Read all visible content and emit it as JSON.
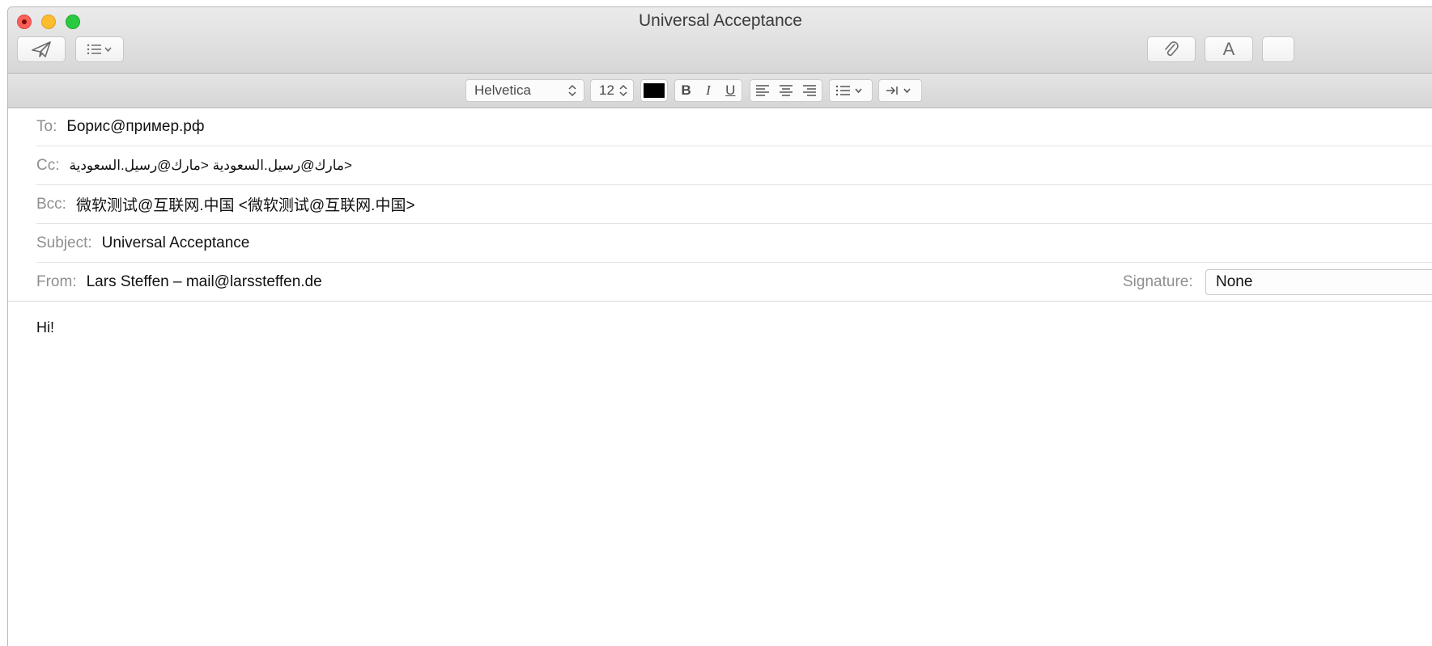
{
  "window": {
    "title": "Universal Acceptance"
  },
  "toolbar": {
    "send_icon": "paper-plane-icon",
    "header_fields_icon": "list-chevron-icon",
    "attach_icon": "paperclip-icon",
    "fonts_label": "A"
  },
  "format": {
    "font": "Helvetica",
    "size": "12",
    "color": "#000000",
    "bold": "B",
    "italic": "I",
    "underline": "U"
  },
  "fields": {
    "to_label": "To:",
    "to_value": "Борис@пример.рф",
    "cc_label": "Cc:",
    "cc_value": "مارك@رسيل.السعودية <مارك@رسيل.السعودية>",
    "bcc_label": "Bcc:",
    "bcc_value": "微软测试@互联网.中国 <微软测试@互联网.中国>",
    "subject_label": "Subject:",
    "subject_value": "Universal Acceptance",
    "from_label": "From:",
    "from_value": "Lars Steffen – mail@larssteffen.de",
    "signature_label": "Signature:",
    "signature_value": "None"
  },
  "message": {
    "body": "Hi!"
  }
}
